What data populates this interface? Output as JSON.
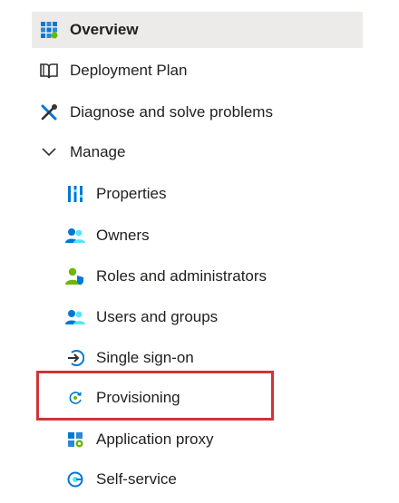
{
  "nav": {
    "overview": {
      "label": "Overview",
      "icon": "overview-grid-icon"
    },
    "deployment_plan": {
      "label": "Deployment Plan",
      "icon": "book-icon"
    },
    "diagnose": {
      "label": "Diagnose and solve problems",
      "icon": "wrench-screwdriver-icon"
    },
    "manage": {
      "label": "Manage",
      "icon": "chevron-down-icon"
    },
    "manage_items": [
      {
        "label": "Properties",
        "icon": "properties-bars-icon"
      },
      {
        "label": "Owners",
        "icon": "users-icon"
      },
      {
        "label": "Roles and administrators",
        "icon": "user-shield-icon"
      },
      {
        "label": "Users and groups",
        "icon": "users-icon"
      },
      {
        "label": "Single sign-on",
        "icon": "sign-in-arrow-icon"
      },
      {
        "label": "Provisioning",
        "icon": "provisioning-cycle-icon"
      },
      {
        "label": "Application proxy",
        "icon": "app-proxy-icon"
      },
      {
        "label": "Self-service",
        "icon": "self-service-icon"
      }
    ]
  },
  "colors": {
    "selected_bg": "#edebe9",
    "highlight_border": "#d13438",
    "azure_blue": "#0078d4"
  }
}
